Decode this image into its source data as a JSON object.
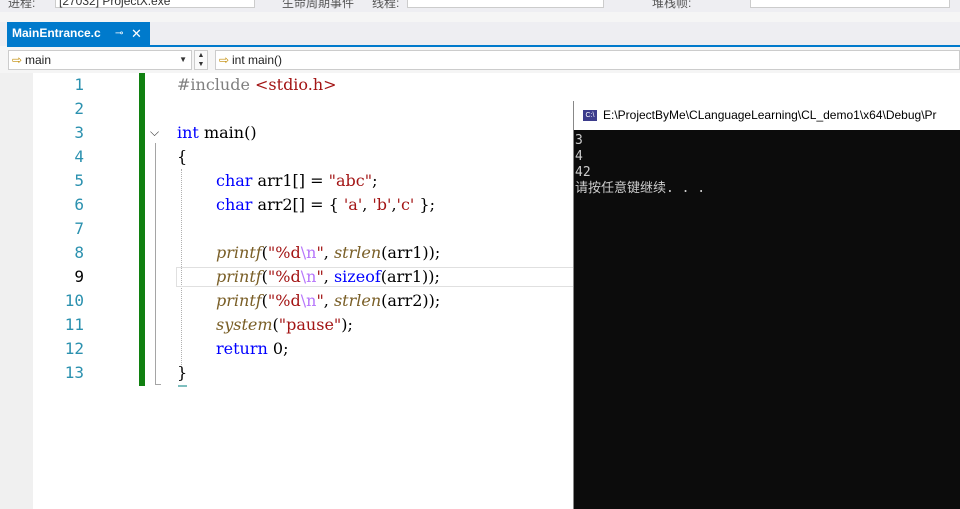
{
  "toolbar": {
    "process_label": "进程:",
    "process_value": "[27032] ProjectX.exe",
    "lifecycle_label": "生命周期事件",
    "thread_label": "线程:",
    "stackframe_label": "堆栈帧:"
  },
  "tab": {
    "title": "MainEntrance.c",
    "pin_icon": "pin-icon",
    "close_icon": "close-icon",
    "accent_color": "#007acc"
  },
  "navbar": {
    "scope": "main",
    "member": "int main()"
  },
  "editor": {
    "current_line": 9,
    "lines": [
      {
        "num": "1"
      },
      {
        "num": "2"
      },
      {
        "num": "3"
      },
      {
        "num": "4"
      },
      {
        "num": "5"
      },
      {
        "num": "6"
      },
      {
        "num": "7"
      },
      {
        "num": "8"
      },
      {
        "num": "9"
      },
      {
        "num": "10"
      },
      {
        "num": "11"
      },
      {
        "num": "12"
      },
      {
        "num": "13"
      }
    ],
    "tokens": {
      "include": "#include",
      "header": "<stdio.h>",
      "int_kw": "int",
      "main_sig": " main()",
      "open_brace": "{",
      "char_kw": "char",
      "arr1_decl": " arr1[] = ",
      "abc_str": "\"abc\"",
      "semicolon": ";",
      "arr2_decl": " arr2[] = { ",
      "char_a": "'a'",
      "comma_sp": ", ",
      "char_b": "'b'",
      "comma": ",",
      "char_c": "'c'",
      "close_init": " };",
      "printf": "printf",
      "open_paren": "(",
      "fmt_open": "\"%d",
      "esc_n": "\\n",
      "fmt_close": "\"",
      "args_sep": ", ",
      "strlen": "strlen",
      "sizeof": "sizeof",
      "arr1_arg": "(arr1));",
      "arr2_arg": "(arr2));",
      "system": "system",
      "pause_str": "\"pause\"",
      "close_stmt": ");",
      "return_kw": "return",
      "return_val": " 0;",
      "close_brace": "}"
    }
  },
  "console": {
    "title": "E:\\ProjectByMe\\CLanguageLearning\\CL_demo1\\x64\\Debug\\Pr",
    "output": [
      "3",
      "4",
      "42",
      "请按任意键继续. . ."
    ]
  }
}
